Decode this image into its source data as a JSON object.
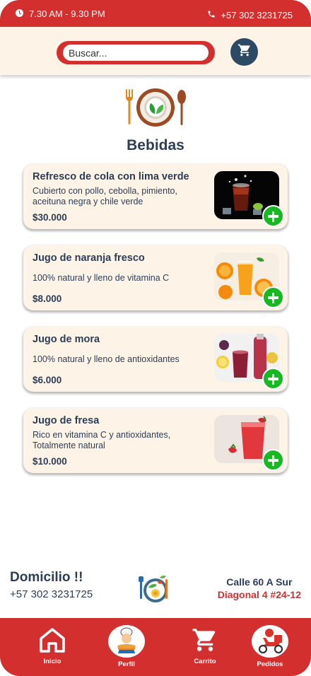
{
  "status": {
    "hours": "7.30 AM - 9.30 PM",
    "phone": "+57 302 3231725"
  },
  "search": {
    "placeholder": "Buscar..."
  },
  "section": {
    "title": "Bebidas"
  },
  "products": [
    {
      "name": "Refresco de cola con lima verde",
      "description": "Cubierto con pollo, cebolla, pimiento, aceituna negra y chile verde",
      "price": "$30.000"
    },
    {
      "name": "Jugo de naranja fresco",
      "description": "100% natural y lleno de vitamina C",
      "price": "$8.000"
    },
    {
      "name": "Jugo de mora",
      "description": "100% natural y  lleno de antioxidantes",
      "price": "$6.000"
    },
    {
      "name": "Jugo de fresa",
      "description": "Rico en vitamina C y antioxidantes, Totalmente natural",
      "price": "$10.000"
    }
  ],
  "delivery": {
    "title": "Domicilio !!",
    "phone": "+57 302 3231725",
    "address_line1": "Calle 60 A Sur",
    "address_line2": "Diagonal 4  #24-12"
  },
  "nav": [
    {
      "label": "Inicio",
      "icon": "home-icon"
    },
    {
      "label": "Perfil",
      "icon": "chef-avatar-icon"
    },
    {
      "label": "Carrito",
      "icon": "cart-icon"
    },
    {
      "label": "Pedidos",
      "icon": "delivery-scooter-icon"
    }
  ],
  "colors": {
    "primary": "#d32f2f",
    "cream": "#fdf3e6",
    "navy": "#2c3e57",
    "add": "#17b821"
  }
}
